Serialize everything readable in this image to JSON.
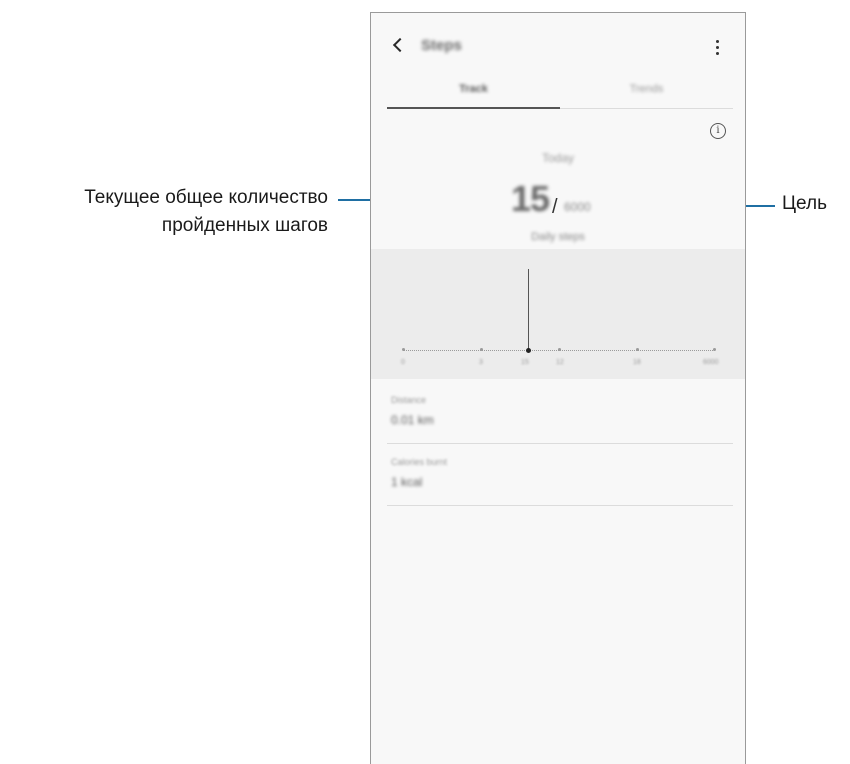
{
  "callouts": {
    "left_line1": "Текущее общее количество",
    "left_line2": "пройденных шагов",
    "right": "Цель"
  },
  "header": {
    "title": "Steps"
  },
  "tabs": [
    {
      "label": "Track",
      "active": true
    },
    {
      "label": "Trends",
      "active": false
    }
  ],
  "summary": {
    "day_label": "Today",
    "step_count": "15",
    "separator": "/",
    "goal": "6000",
    "steps_unit": "Daily steps"
  },
  "chart_ticks": [
    "0",
    "3",
    "15",
    "12",
    "18",
    "6000"
  ],
  "stats": [
    {
      "label": "Distance",
      "value": "0.01 km"
    },
    {
      "label": "Calories burnt",
      "value": "1 kcal"
    }
  ],
  "colors": {
    "leader_line": "#1f6fa3",
    "chart_bg": "#ececec"
  }
}
